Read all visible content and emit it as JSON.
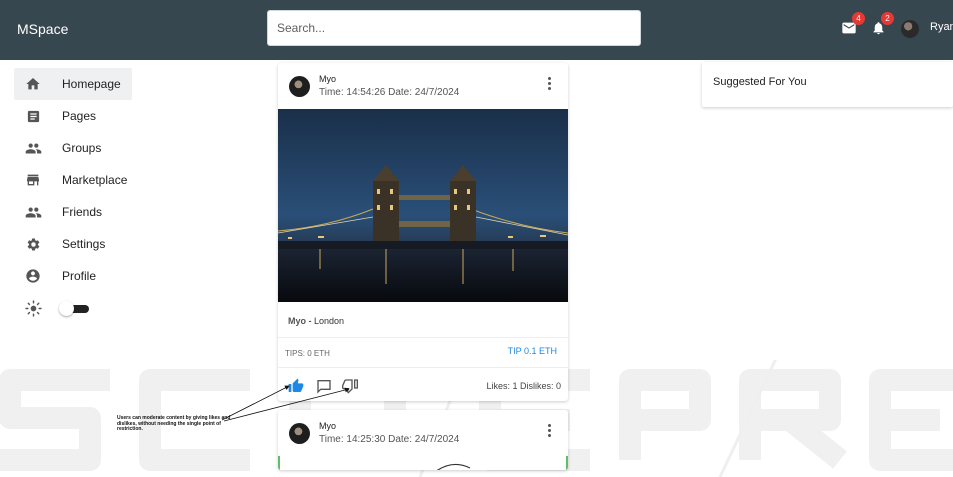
{
  "app": {
    "title": "MSpace"
  },
  "search": {
    "placeholder": "Search..."
  },
  "header": {
    "mail_badge": "4",
    "notifications_badge": "2",
    "user_name": "Ryan"
  },
  "sidebar": {
    "items": [
      {
        "label": "Homepage",
        "icon": "home-icon",
        "active": true
      },
      {
        "label": "Pages",
        "icon": "article-icon"
      },
      {
        "label": "Groups",
        "icon": "people-icon"
      },
      {
        "label": "Marketplace",
        "icon": "storefront-icon"
      },
      {
        "label": "Friends",
        "icon": "people-icon"
      },
      {
        "label": "Settings",
        "icon": "gear-icon"
      },
      {
        "label": "Profile",
        "icon": "account-circle-icon"
      }
    ],
    "theme_toggle": {
      "icon": "sun-icon",
      "on": false
    }
  },
  "posts": [
    {
      "author": "Myo",
      "time_date": "Time: 14:54:26 Date: 24/7/2024",
      "caption_author": "Myo - ",
      "caption_text": "London",
      "tips": "TIPS: 0 ETH",
      "tip_button": "TIP 0.1 ETH",
      "counts": "Likes: 1  Dislikes: 0",
      "liked": true
    },
    {
      "author": "Myo",
      "time_date": "Time: 14:25:30 Date: 24/7/2024"
    }
  ],
  "suggest": {
    "title": "Suggested For You"
  },
  "annotation": {
    "text": "Users can moderate content by giving likes and dislikes, without needing the single point of restriction."
  },
  "colors": {
    "header": "#37474f",
    "accent": "#1e88e5",
    "badge": "#e53935",
    "active_item": "#eef0f2"
  }
}
